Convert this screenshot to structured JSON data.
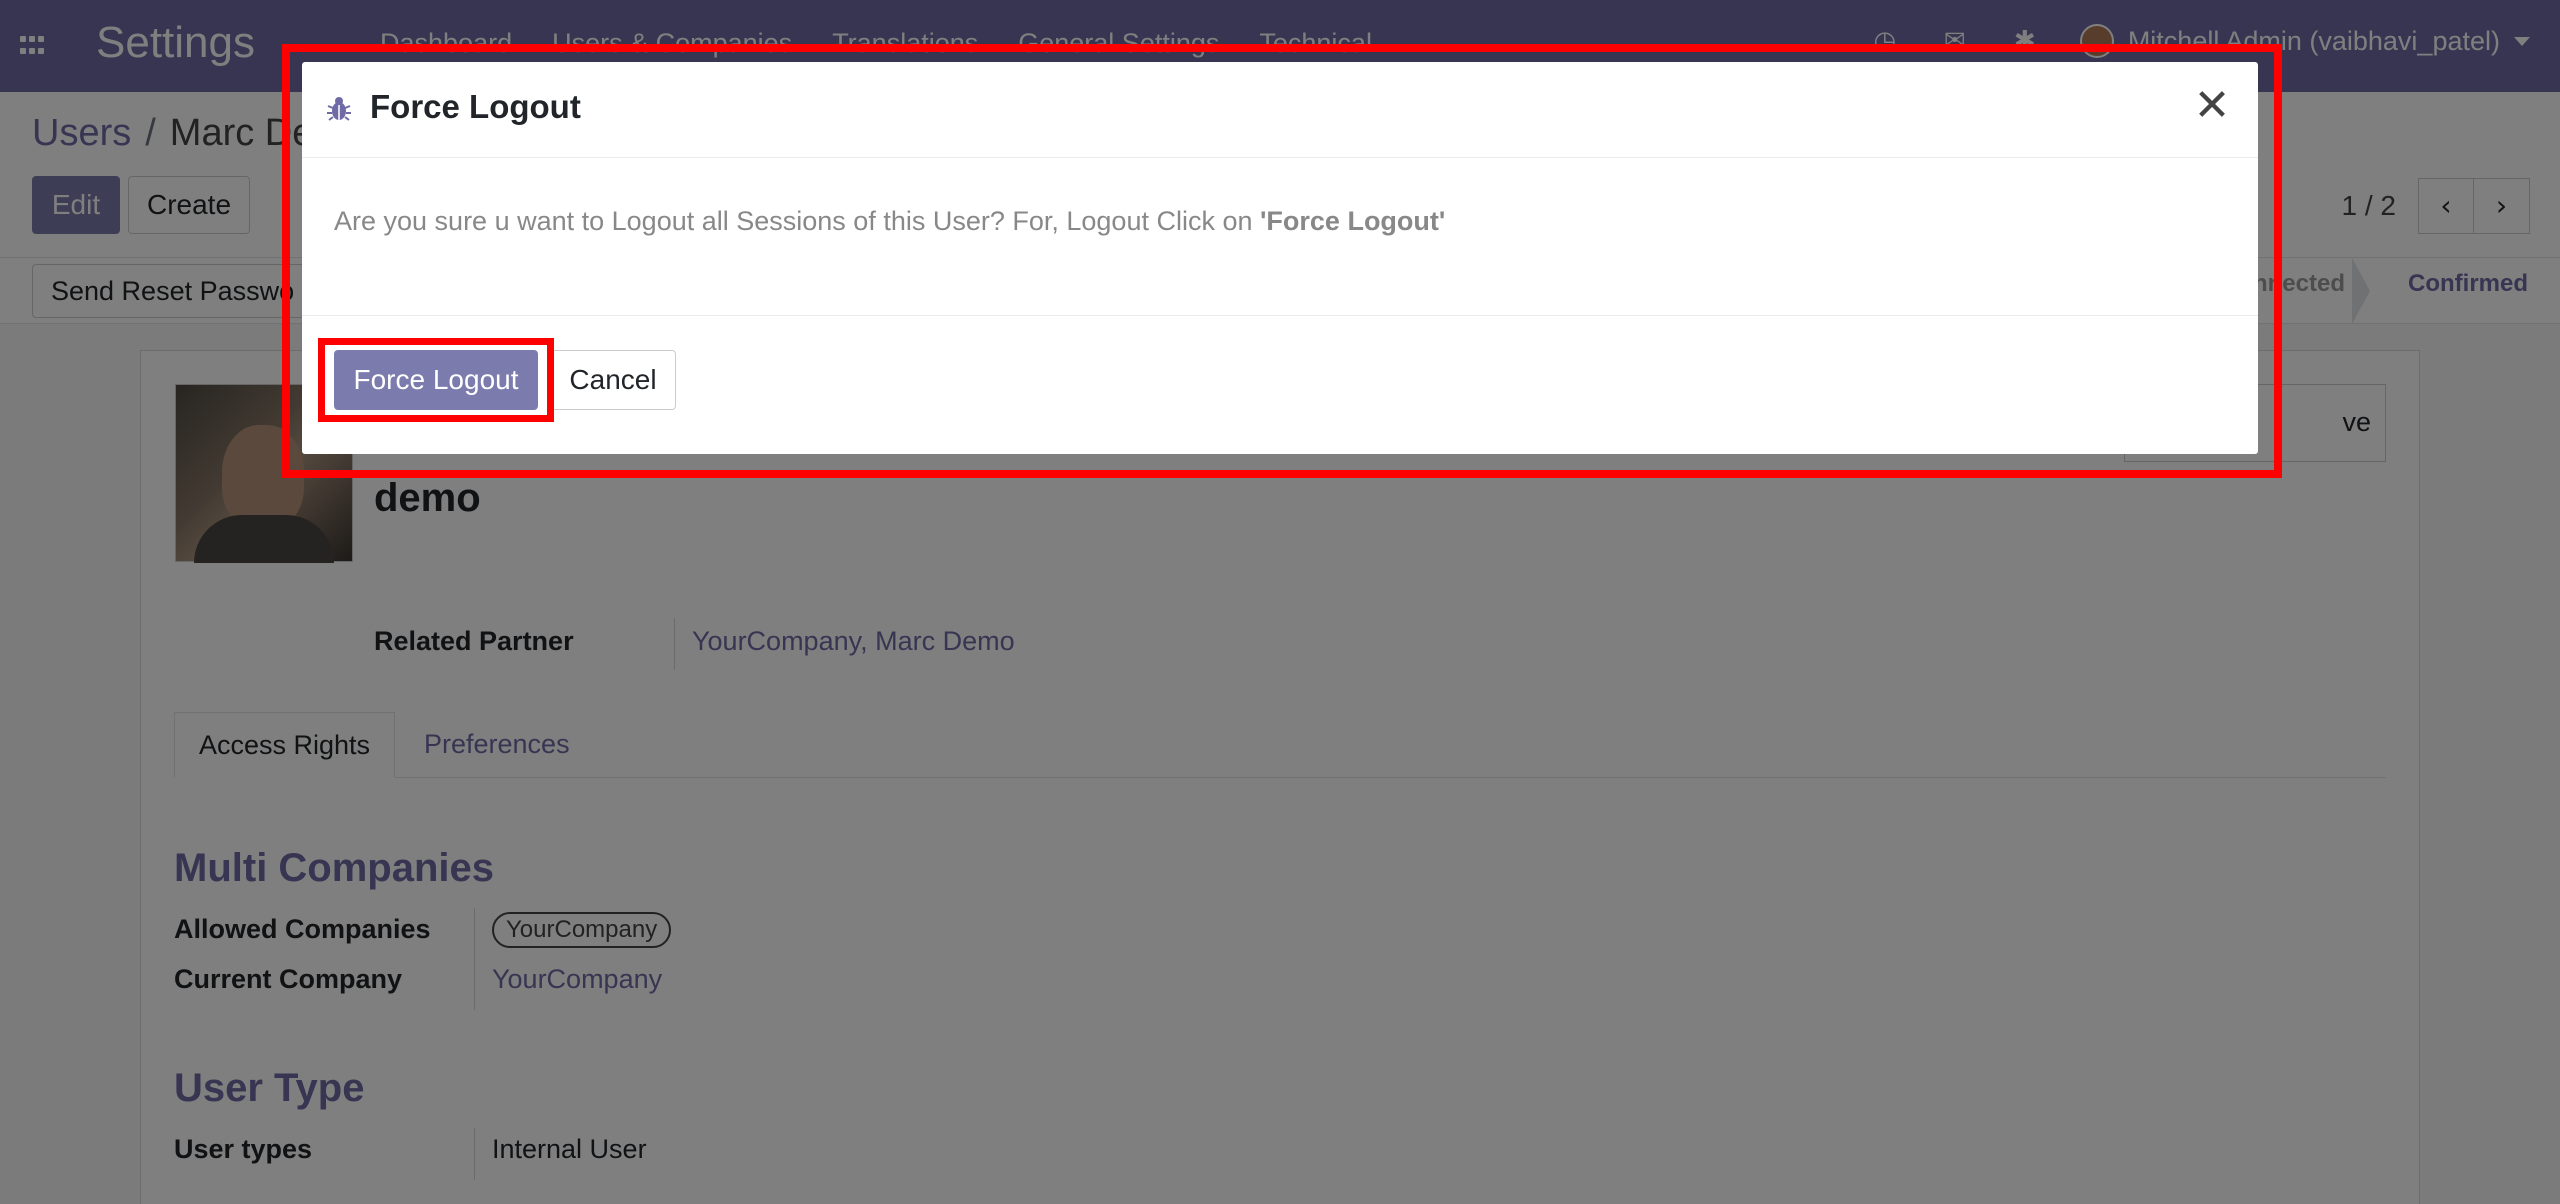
{
  "app": {
    "title": "Settings",
    "menu": [
      "Dashboard",
      "Users & Companies",
      "Translations",
      "General Settings",
      "Technical"
    ],
    "user": "Mitchell Admin (vaibhavi_patel)"
  },
  "control_panel": {
    "breadcrumb_root": "Users",
    "breadcrumb_separator": "/",
    "breadcrumb_current": "Marc De",
    "edit_label": "Edit",
    "create_label": "Create",
    "pager_value": "1 / 2"
  },
  "statusbar": {
    "reset_password_label": "Send Reset Passwo",
    "stage_never": "nnected",
    "stage_confirmed": "Confirmed"
  },
  "form": {
    "archive_label": "ve",
    "name": "demo",
    "related_partner_label": "Related Partner",
    "related_partner_value": "YourCompany, Marc Demo",
    "tabs": [
      "Access Rights",
      "Preferences"
    ],
    "multi_companies_title": "Multi Companies",
    "allowed_companies_label": "Allowed Companies",
    "allowed_companies_tag": "YourCompany",
    "current_company_label": "Current Company",
    "current_company_value": "YourCompany",
    "user_type_title": "User Type",
    "user_types_label": "User types",
    "user_types_value": "Internal User"
  },
  "dialog": {
    "title": "Force Logout",
    "message_prefix": "Are you sure u want to Logout all Sessions of this User? For, Logout Click on ",
    "message_emphasis": "'Force Logout'",
    "confirm_label": "Force Logout",
    "cancel_label": "Cancel"
  },
  "colors": {
    "brand": "#6f6aa5",
    "primary_button": "#7c7bad",
    "highlight": "#ff0000"
  },
  "icons": {
    "apps": "apps-grid-icon",
    "close": "close-icon",
    "bug": "bug-icon",
    "pager_prev": "chevron-left-icon",
    "pager_next": "chevron-right-icon"
  }
}
